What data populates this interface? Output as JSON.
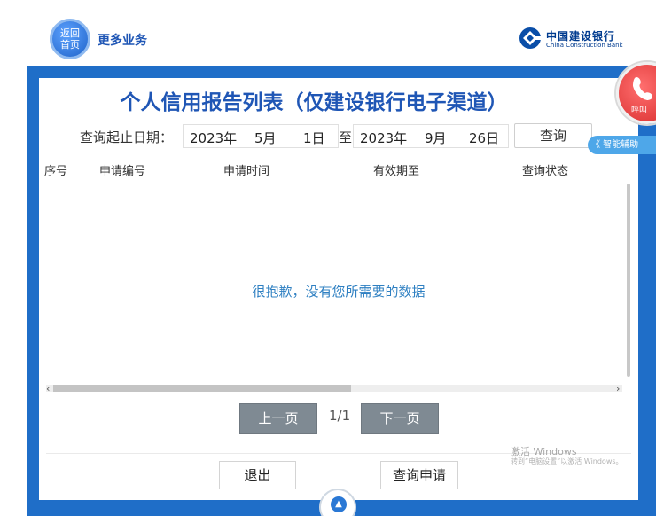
{
  "header": {
    "home_button": "返回\n首页",
    "more_business": "更多业务",
    "bank_name_cn": "中国建设银行",
    "bank_name_en": "China Construction Bank"
  },
  "page_title": "个人信用报告列表（仅建设银行电子渠道）",
  "query": {
    "date_label": "查询起止日期：",
    "start": {
      "year": "2023年",
      "month": "5月",
      "day": "1日"
    },
    "to_label": "至",
    "end": {
      "year": "2023年",
      "month": "9月",
      "day": "26日"
    },
    "button": "查询"
  },
  "table": {
    "columns": [
      "序号",
      "申请编号",
      "申请时间",
      "有效期至",
      "查询状态"
    ],
    "empty_message": "很抱歉，没有您所需要的数据"
  },
  "pager": {
    "prev": "上一页",
    "indicator": "1/1",
    "next": "下一页"
  },
  "actions": {
    "exit": "退出",
    "apply": "查询申请"
  },
  "side": {
    "call": "呼叫",
    "assist": "《 智能辅助"
  },
  "windows_watermark": {
    "line1": "激活 Windows",
    "line2": "转到“电脑设置”以激活 Windows。"
  },
  "colors": {
    "brand_blue": "#1f56b5",
    "frame_blue": "#1f6ec8",
    "pager_gray": "#7f8a93",
    "call_red": "#d82c2c"
  }
}
